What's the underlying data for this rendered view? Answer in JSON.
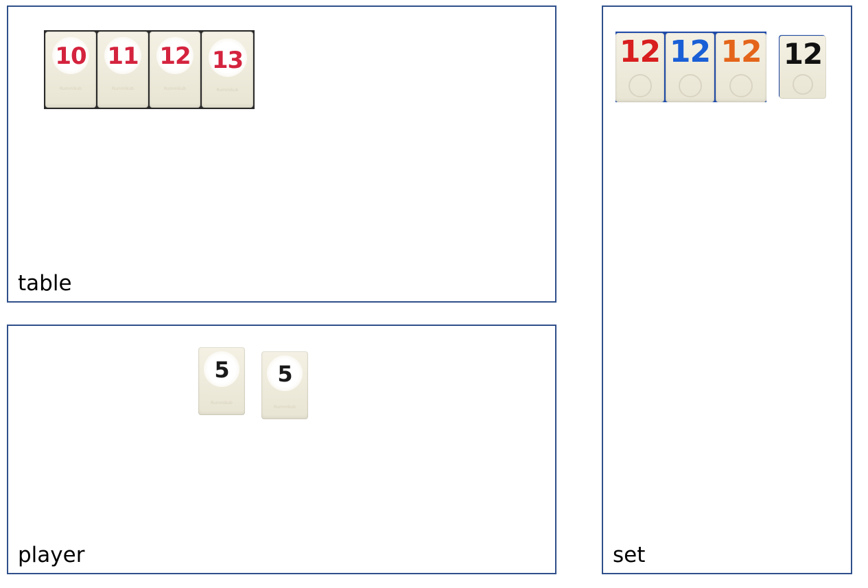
{
  "panels": {
    "table": {
      "label": "table"
    },
    "player": {
      "label": "player"
    },
    "set": {
      "label": "set"
    }
  },
  "table_tiles": [
    {
      "number": "10",
      "color": "#d4233e"
    },
    {
      "number": "11",
      "color": "#d4233e"
    },
    {
      "number": "12",
      "color": "#d4233e"
    },
    {
      "number": "13",
      "color": "#d4233e"
    }
  ],
  "player_tiles": [
    {
      "number": "5",
      "color": "#1a1a1a"
    },
    {
      "number": "5",
      "color": "#1a1a1a"
    }
  ],
  "set_tiles": [
    {
      "number": "12",
      "color": "#d81e1e"
    },
    {
      "number": "12",
      "color": "#1a5fd6"
    },
    {
      "number": "12",
      "color": "#e4651a"
    },
    {
      "number": "12",
      "color": "#111111"
    }
  ]
}
